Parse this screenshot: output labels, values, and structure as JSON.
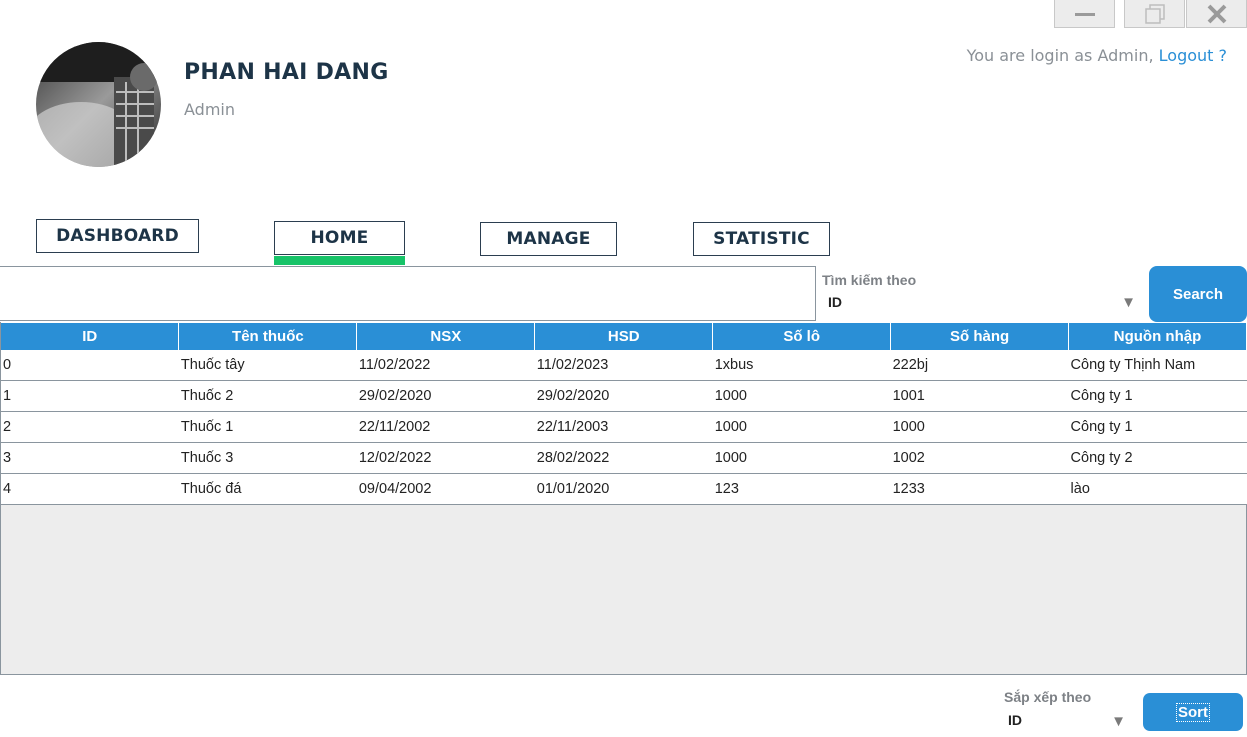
{
  "window": {
    "controls": [
      "minimize-icon",
      "restore-icon",
      "close-icon"
    ]
  },
  "profile": {
    "name": "PHAN HAI DANG",
    "role": "Admin"
  },
  "login": {
    "text": "You are login as Admin, ",
    "logout": "Logout ?"
  },
  "nav": {
    "dashboard": "DASHBOARD",
    "home": "HOME",
    "manage": "MANAGE",
    "statistic": "STATISTIC",
    "active": "HOME",
    "active_color": "#17c368"
  },
  "search": {
    "value": "",
    "by_label": "Tìm kiếm theo",
    "by_value": "ID",
    "button": "Search"
  },
  "table": {
    "columns": [
      "ID",
      "Tên thuốc",
      "NSX",
      "HSD",
      "Số lô",
      "Số hàng",
      "Nguồn nhập"
    ],
    "rows": [
      [
        "0",
        "Thuốc tây",
        "11/02/2022",
        "11/02/2023",
        "1xbus",
        "222bj",
        "Công ty Thịnh Nam"
      ],
      [
        "1",
        "Thuốc 2",
        "29/02/2020",
        "29/02/2020",
        "1000",
        "1001",
        "Công ty 1"
      ],
      [
        "2",
        "Thuốc 1",
        "22/11/2002",
        "22/11/2003",
        "1000",
        "1000",
        "Công ty 1"
      ],
      [
        "3",
        "Thuốc 3",
        "12/02/2022",
        "28/02/2022",
        "1000",
        "1002",
        "Công ty 2"
      ],
      [
        "4",
        "Thuốc đá",
        "09/04/2002",
        "01/01/2020",
        "123",
        "1233",
        "lào"
      ]
    ]
  },
  "sort": {
    "by_label": "Sắp xếp theo",
    "by_value": "ID",
    "button": "Sort"
  },
  "colors": {
    "accent": "#2a8fd6",
    "heading": "#1d3447",
    "muted": "#8a9096"
  }
}
